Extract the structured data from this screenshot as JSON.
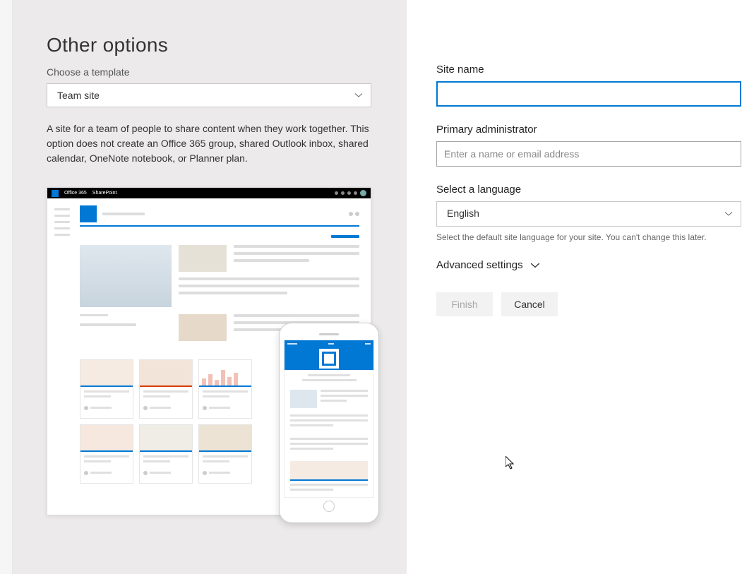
{
  "left": {
    "title": "Other options",
    "template_label": "Choose a template",
    "template_selected": "Team site",
    "description": "A site for a team of people to share content when they work together. This option does not create an Office 365 group, shared Outlook inbox, shared calendar, OneNote notebook, or Planner plan.",
    "preview_suitebar": {
      "product": "Office 365",
      "app": "SharePoint"
    }
  },
  "right": {
    "site_name_label": "Site name",
    "site_name_value": "",
    "primary_admin_label": "Primary administrator",
    "primary_admin_placeholder": "Enter a name or email address",
    "language_label": "Select a language",
    "language_selected": "English",
    "language_help": "Select the default site language for your site. You can't change this later.",
    "advanced_label": "Advanced settings",
    "finish_label": "Finish",
    "cancel_label": "Cancel"
  }
}
